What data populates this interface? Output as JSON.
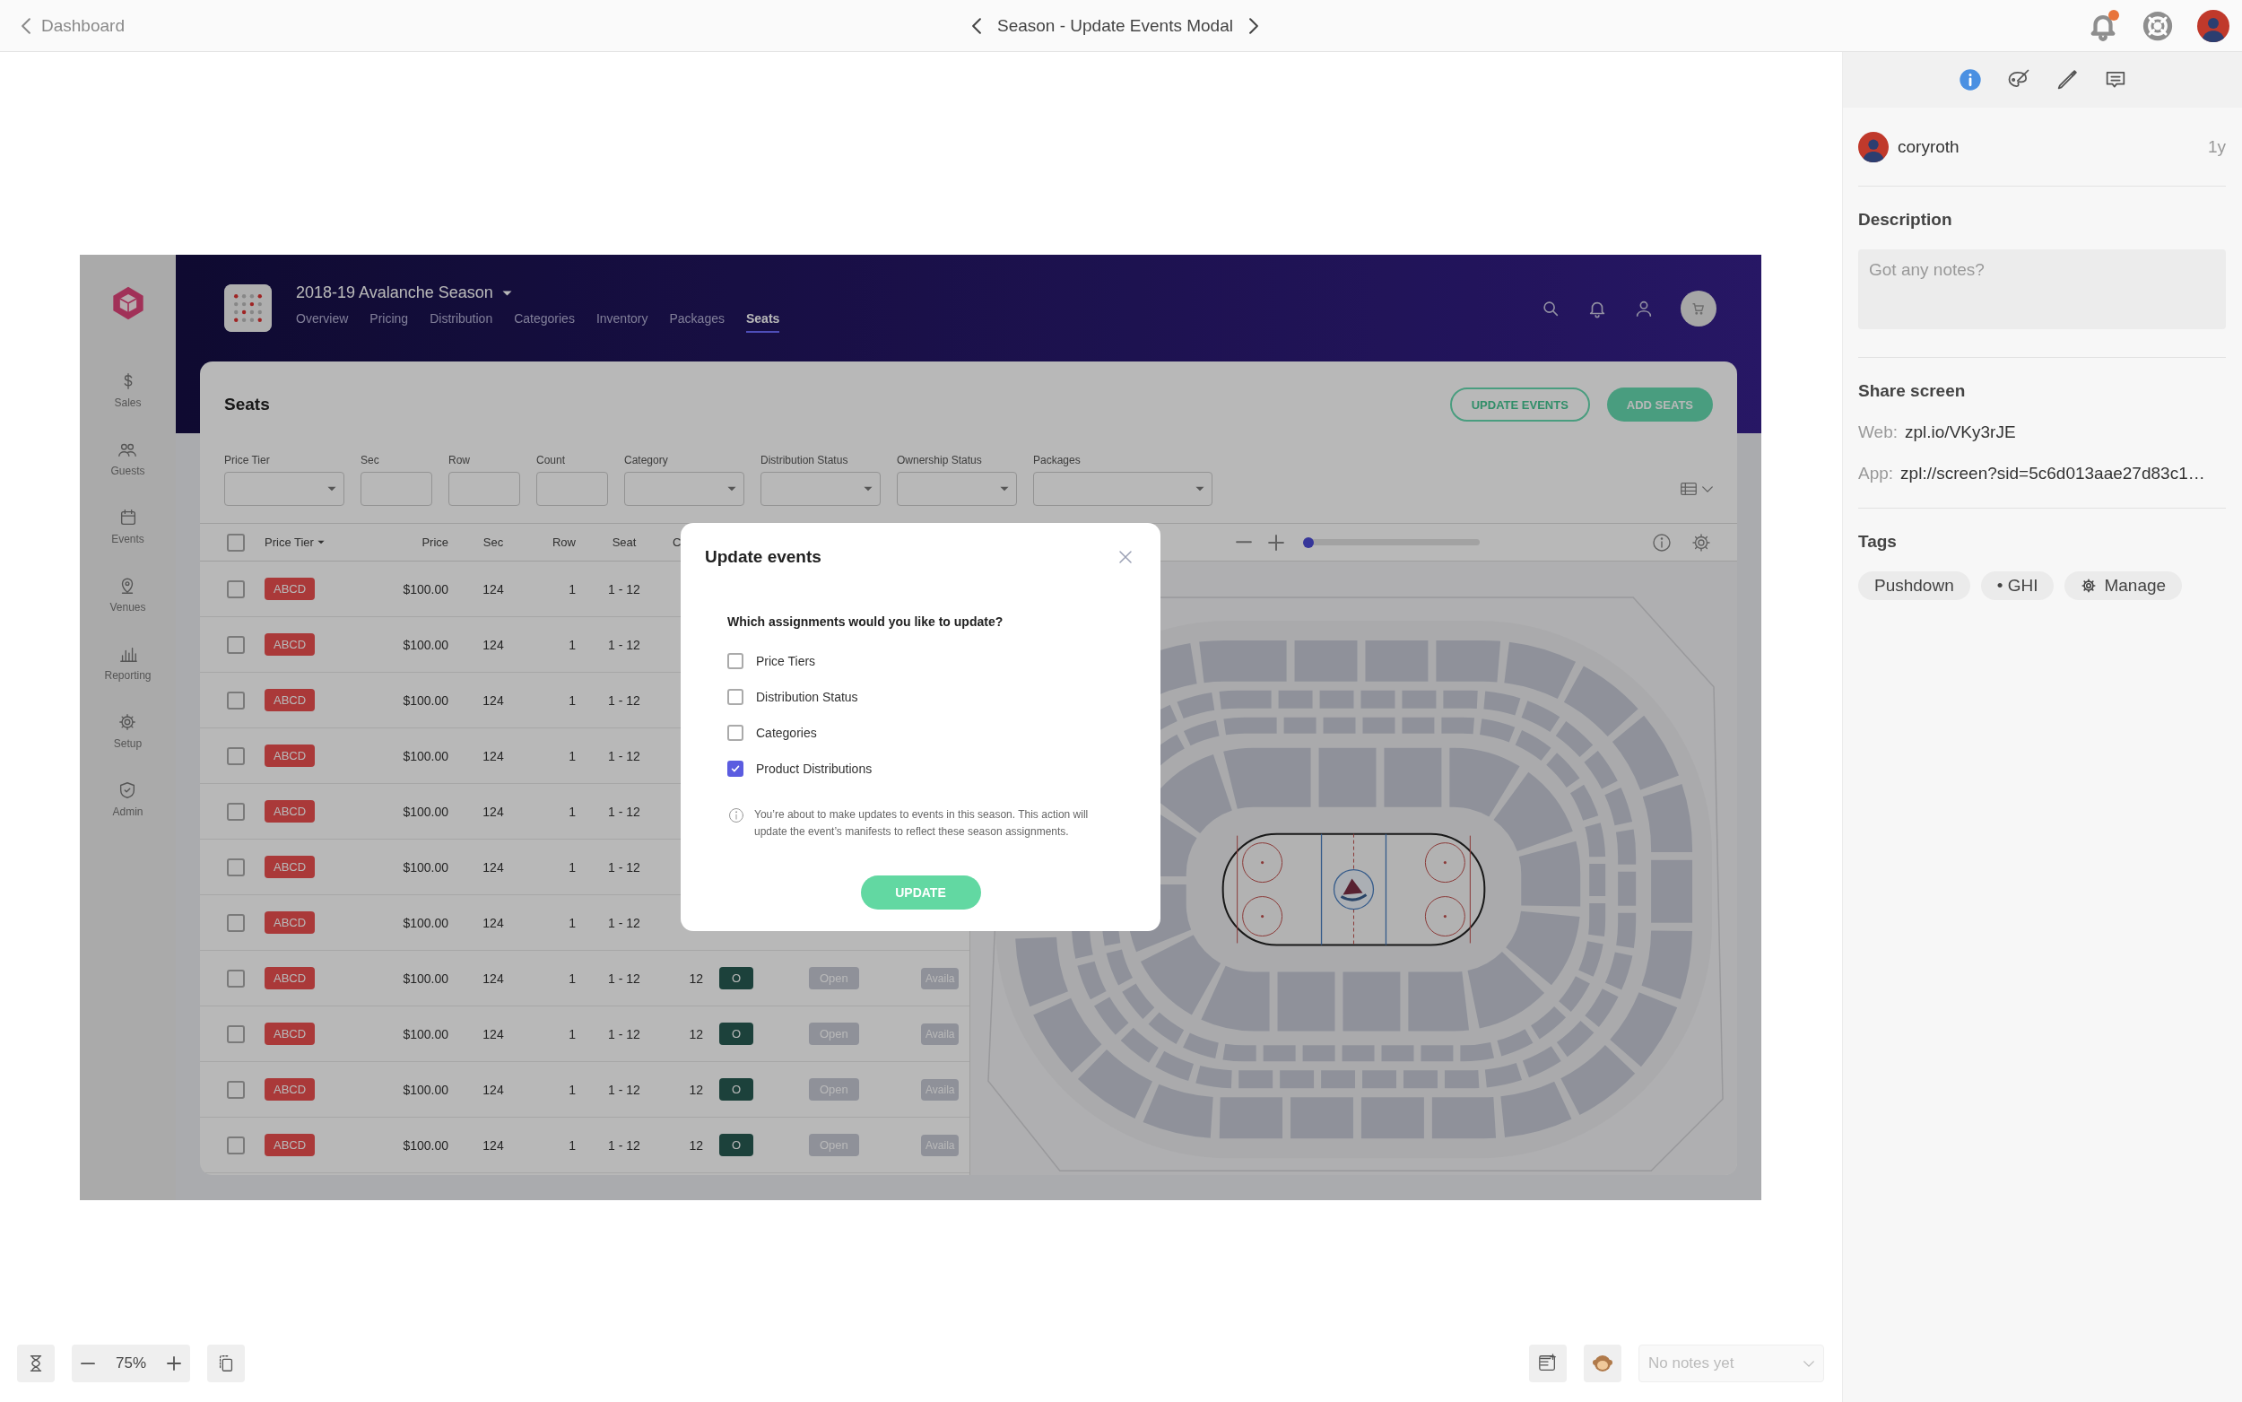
{
  "topbar": {
    "back_label": "Dashboard",
    "title": "Season - Update Events Modal"
  },
  "screen": {
    "sidebar": [
      {
        "label": "Sales",
        "kind": "dollar"
      },
      {
        "label": "Guests",
        "kind": "people"
      },
      {
        "label": "Events",
        "kind": "calendar"
      },
      {
        "label": "Venues",
        "kind": "pin"
      },
      {
        "label": "Reporting",
        "kind": "chart"
      },
      {
        "label": "Setup",
        "kind": "gear"
      },
      {
        "label": "Admin",
        "kind": "shield"
      }
    ],
    "season_title": "2018-19 Avalanche Season",
    "tabs": [
      {
        "label": "Overview",
        "selected": false
      },
      {
        "label": "Pricing",
        "selected": false
      },
      {
        "label": "Distribution",
        "selected": false
      },
      {
        "label": "Categories",
        "selected": false
      },
      {
        "label": "Inventory",
        "selected": false
      },
      {
        "label": "Packages",
        "selected": false
      },
      {
        "label": "Seats",
        "selected": true
      }
    ],
    "card_title": "Seats",
    "buttons": [
      {
        "label": "UPDATE EVENTS",
        "kind": "outline"
      },
      {
        "label": "ADD SEATS",
        "kind": "filled"
      }
    ],
    "filters": [
      {
        "label": "Price Tier",
        "kind": "select"
      },
      {
        "label": "Sec",
        "kind": "input"
      },
      {
        "label": "Row",
        "kind": "input"
      },
      {
        "label": "Count",
        "kind": "input"
      },
      {
        "label": "Category",
        "kind": "select"
      },
      {
        "label": "Distribution Status",
        "kind": "select"
      },
      {
        "label": "Ownership Status",
        "kind": "select"
      },
      {
        "label": "Packages",
        "kind": "select"
      }
    ],
    "all_selected": false,
    "columns": [
      "Price Tier",
      "Price",
      "Sec",
      "Row",
      "Seat",
      "C"
    ],
    "rows": [
      {
        "selected": false,
        "tier": "ABCD",
        "price": "$100.00",
        "sec": "124",
        "row": "1",
        "seat": "1 - 12"
      },
      {
        "selected": false,
        "tier": "ABCD",
        "price": "$100.00",
        "sec": "124",
        "row": "1",
        "seat": "1 - 12"
      },
      {
        "selected": false,
        "tier": "ABCD",
        "price": "$100.00",
        "sec": "124",
        "row": "1",
        "seat": "1 - 12"
      },
      {
        "selected": false,
        "tier": "ABCD",
        "price": "$100.00",
        "sec": "124",
        "row": "1",
        "seat": "1 - 12"
      },
      {
        "selected": false,
        "tier": "ABCD",
        "price": "$100.00",
        "sec": "124",
        "row": "1",
        "seat": "1 - 12"
      },
      {
        "selected": false,
        "tier": "ABCD",
        "price": "$100.00",
        "sec": "124",
        "row": "1",
        "seat": "1 - 12"
      },
      {
        "selected": false,
        "tier": "ABCD",
        "price": "$100.00",
        "sec": "124",
        "row": "1",
        "seat": "1 - 12"
      },
      {
        "selected": false,
        "tier": "ABCD",
        "price": "$100.00",
        "sec": "124",
        "row": "1",
        "seat": "1 - 12",
        "count": "12",
        "ownership": "O",
        "distribution": "Open",
        "availability": "Availa"
      },
      {
        "selected": false,
        "tier": "ABCD",
        "price": "$100.00",
        "sec": "124",
        "row": "1",
        "seat": "1 - 12",
        "count": "12",
        "ownership": "O",
        "distribution": "Open",
        "availability": "Availa"
      },
      {
        "selected": false,
        "tier": "ABCD",
        "price": "$100.00",
        "sec": "124",
        "row": "1",
        "seat": "1 - 12",
        "count": "12",
        "ownership": "O",
        "distribution": "Open",
        "availability": "Availa"
      },
      {
        "selected": false,
        "tier": "ABCD",
        "price": "$100.00",
        "sec": "124",
        "row": "1",
        "seat": "1 - 12",
        "count": "12",
        "ownership": "O",
        "distribution": "Open",
        "availability": "Availa"
      }
    ],
    "map_zoom": {
      "level": 0
    },
    "modal": {
      "title": "Update events",
      "question": "Which assignments would you like to update?",
      "options": [
        {
          "label": "Price Tiers",
          "checked": false
        },
        {
          "label": "Distribution Status",
          "checked": false
        },
        {
          "label": "Categories",
          "checked": false
        },
        {
          "label": "Product Distributions",
          "checked": true
        }
      ],
      "note": "You’re about to make updates to events in this season. This action will update the event’s manifests to reflect these season assignments.",
      "button": "UPDATE"
    }
  },
  "panel": {
    "tabs": [
      {
        "kind": "info",
        "selected": true
      },
      {
        "kind": "palette",
        "selected": false
      },
      {
        "kind": "pen",
        "selected": false
      },
      {
        "kind": "comment",
        "selected": false
      }
    ],
    "user": {
      "name": "coryroth",
      "time": "1y"
    },
    "description": {
      "heading": "Description",
      "placeholder": "Got any notes?"
    },
    "share": {
      "heading": "Share screen",
      "links": [
        {
          "label": "Web:",
          "value": "zpl.io/VKy3rJE"
        },
        {
          "label": "App:",
          "value": "zpl://screen?sid=5c6d013aae27d83c1…"
        }
      ]
    },
    "tags": {
      "heading": "Tags",
      "items": [
        {
          "label": "Pushdown",
          "kind": "tag"
        },
        {
          "label": "• GHI",
          "kind": "tag"
        },
        {
          "label": "Manage",
          "kind": "action"
        }
      ]
    }
  },
  "bottom": {
    "zoom": "75%",
    "notes_placeholder": "No notes yet"
  }
}
